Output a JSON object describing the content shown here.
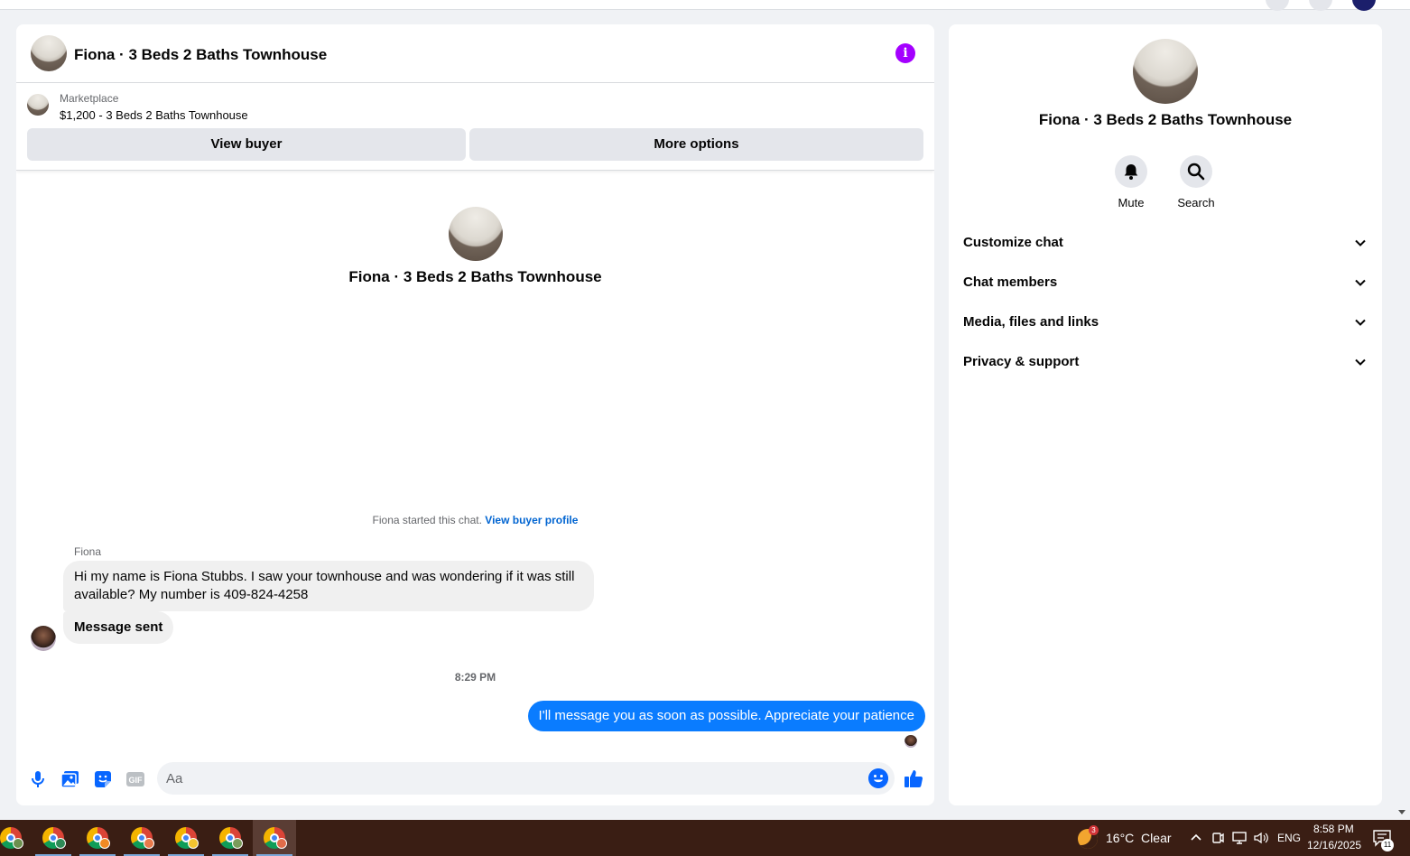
{
  "chat": {
    "title": "Fiona · 3 Beds 2 Baths Townhouse",
    "marketplace": {
      "label": "Marketplace",
      "listing": "$1,200 - 3 Beds 2 Baths Townhouse",
      "view_buyer": "View buyer",
      "more_options": "More options"
    },
    "intro_title": "Fiona · 3 Beds 2 Baths Townhouse",
    "started_text": "Fiona started this chat.",
    "started_link": "View buyer profile",
    "sender_name": "Fiona",
    "messages": [
      {
        "text": "Hi my name is Fiona Stubbs. I saw your townhouse and was wondering if it was still available? My number is 409-824-4258"
      },
      {
        "text": "Message sent"
      }
    ],
    "timestamp": "8:29 PM",
    "outgoing": "I'll message you as soon as possible. Appreciate your patience",
    "composer": {
      "placeholder": "Aa"
    },
    "accent": "#0866ff",
    "info_color": "#a400ff"
  },
  "info_panel": {
    "title": "Fiona · 3 Beds 2 Baths Townhouse",
    "actions": [
      {
        "label": "Mute",
        "icon": "bell-icon"
      },
      {
        "label": "Search",
        "icon": "search-icon"
      }
    ],
    "sections": [
      {
        "label": "Customize chat"
      },
      {
        "label": "Chat members"
      },
      {
        "label": "Media, files and links"
      },
      {
        "label": "Privacy & support"
      }
    ]
  },
  "taskbar": {
    "weather_badge": "3",
    "weather": "16°C  Clear",
    "lang": "ENG",
    "time": "8:58 PM",
    "date": "12/16/2025",
    "notifications": "11"
  }
}
